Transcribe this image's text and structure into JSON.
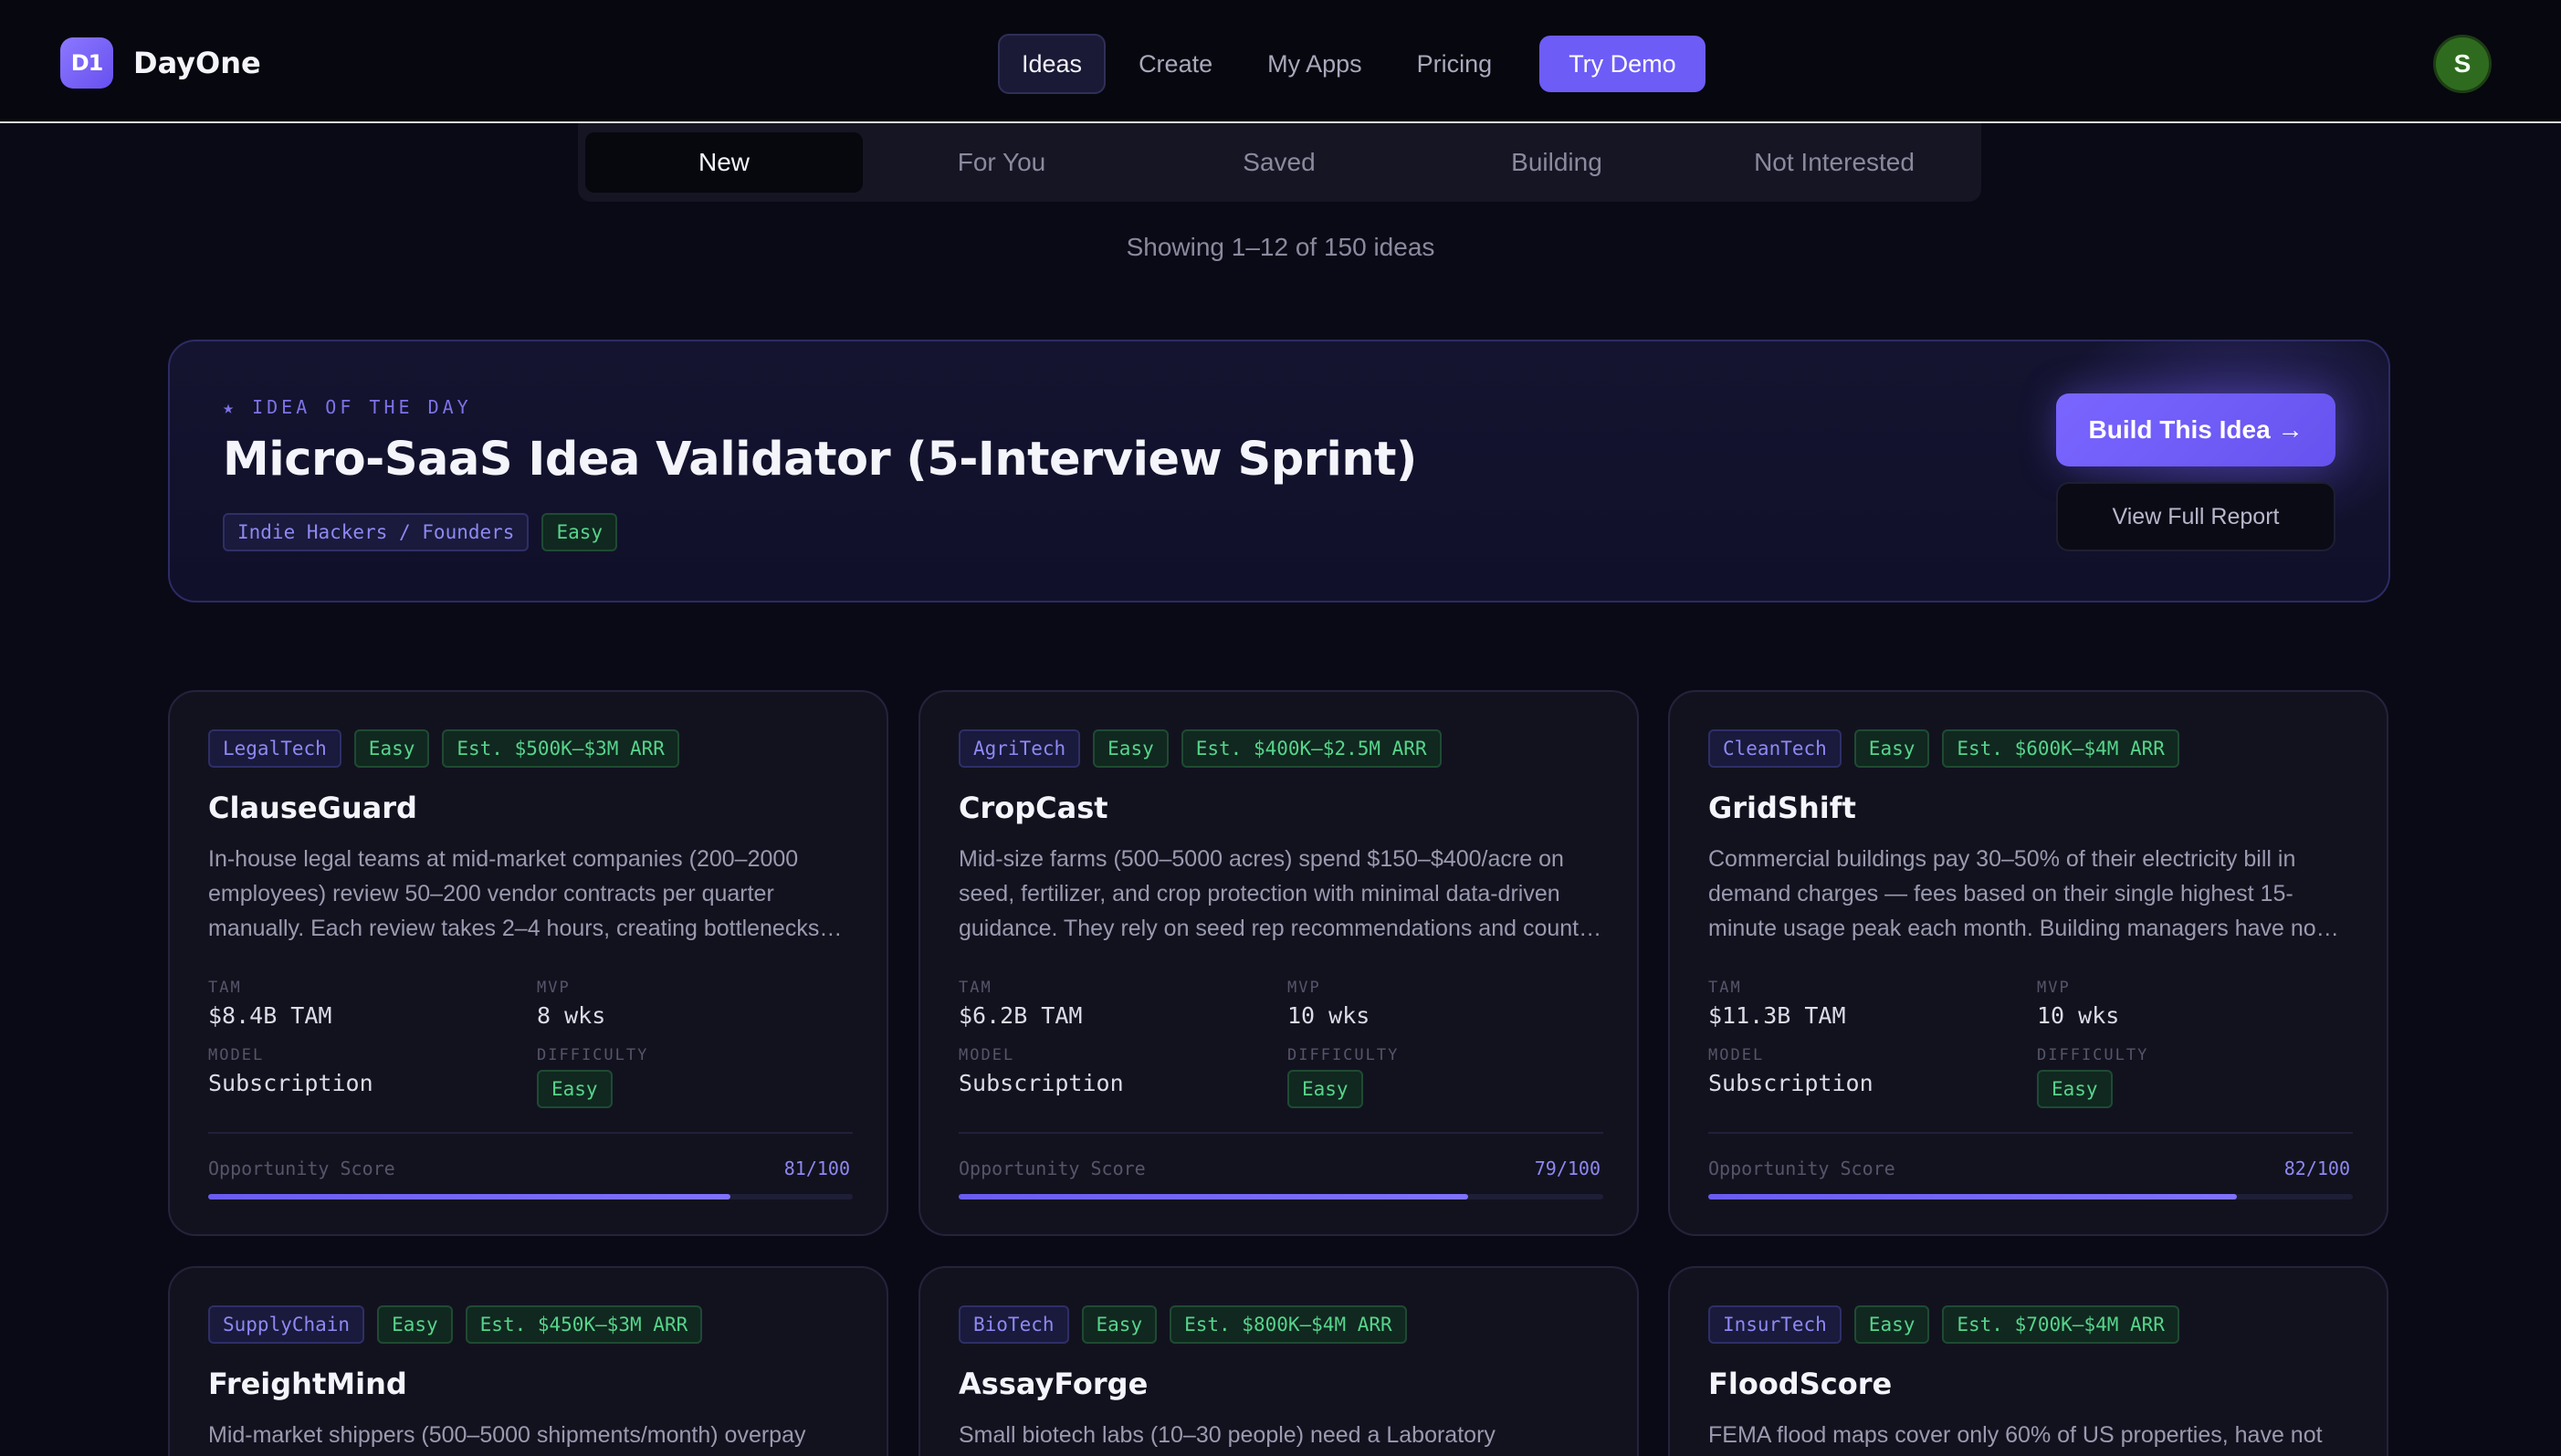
{
  "brand": {
    "logo_text": "D1",
    "name": "DayOne"
  },
  "nav": {
    "items": [
      {
        "label": "Ideas",
        "active": true
      },
      {
        "label": "Create"
      },
      {
        "label": "My Apps"
      },
      {
        "label": "Pricing"
      }
    ],
    "cta": "Try Demo"
  },
  "user": {
    "avatar_initial": "S",
    "avatar_color": "#2f6b1f"
  },
  "tabs": [
    {
      "label": "New",
      "active": true
    },
    {
      "label": "For You"
    },
    {
      "label": "Saved"
    },
    {
      "label": "Building"
    },
    {
      "label": "Not Interested"
    }
  ],
  "showing": "Showing 1–12 of 150 ideas",
  "idea_of_the_day": {
    "kicker": "★ IDEA OF THE DAY",
    "title": "Micro-SaaS Idea Validator (5-Interview Sprint)",
    "tags": [
      "Indie Hackers / Founders",
      "Easy"
    ],
    "build_label": "Build This Idea →",
    "report_label": "View Full Report"
  },
  "card_labels": {
    "tam": "TAM",
    "mvp": "MVP",
    "model": "MODEL",
    "difficulty": "DIFFICULTY",
    "score": "Opportunity Score"
  },
  "cards": [
    {
      "category": "LegalTech",
      "difficulty": "Easy",
      "arr": "Est. $500K–$3M ARR",
      "title": "ClauseGuard",
      "desc": "In-house legal teams at mid-market companies (200–2000 employees) review 50–200 vendor contracts per quarter manually. Each review takes 2–4 hours, creating bottlenecks…",
      "tam": "$8.4B TAM",
      "mvp": "8 wks",
      "model": "Subscription",
      "score_text": "81/100",
      "score": 81
    },
    {
      "category": "AgriTech",
      "difficulty": "Easy",
      "arr": "Est. $400K–$2.5M ARR",
      "title": "CropCast",
      "desc": "Mid-size farms (500–5000 acres) spend $150–$400/acre on seed, fertilizer, and crop protection with minimal data-driven guidance. They rely on seed rep recommendations and count…",
      "tam": "$6.2B TAM",
      "mvp": "10 wks",
      "model": "Subscription",
      "score_text": "79/100",
      "score": 79
    },
    {
      "category": "CleanTech",
      "difficulty": "Easy",
      "arr": "Est. $600K–$4M ARR",
      "title": "GridShift",
      "desc": "Commercial buildings pay 30–50% of their electricity bill in demand charges — fees based on their single highest 15-minute usage peak each month. Building managers have no…",
      "tam": "$11.3B TAM",
      "mvp": "10 wks",
      "model": "Subscription",
      "score_text": "82/100",
      "score": 82
    },
    {
      "category": "SupplyChain",
      "difficulty": "Easy",
      "arr": "Est. $450K–$3M ARR",
      "title": "FreightMind",
      "desc": "Mid-market shippers (500–5000 shipments/month) overpay"
    },
    {
      "category": "BioTech",
      "difficulty": "Easy",
      "arr": "Est. $800K–$4M ARR",
      "title": "AssayForge",
      "desc": "Small biotech labs (10–30 people) need a Laboratory"
    },
    {
      "category": "InsurTech",
      "difficulty": "Easy",
      "arr": "Est. $700K–$4M ARR",
      "title": "FloodScore",
      "desc": "FEMA flood maps cover only 60% of US properties, have not"
    }
  ]
}
